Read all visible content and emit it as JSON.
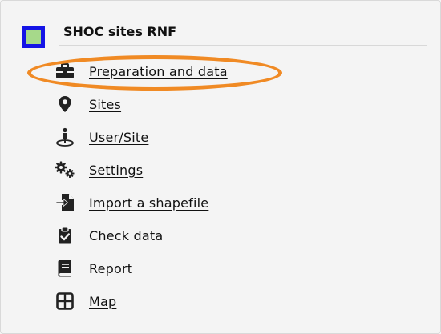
{
  "app": {
    "title": "SHOC sites RNF",
    "logo_fill": "#a6d98a",
    "logo_border": "#1414e6"
  },
  "highlight": {
    "color": "#f08a24",
    "target": "menu-item-preparation-and-data"
  },
  "menu": {
    "items": [
      {
        "label": "Preparation and data",
        "icon": "briefcase-icon"
      },
      {
        "label": "Sites",
        "icon": "map-marker-icon"
      },
      {
        "label": "User/Site",
        "icon": "user-location-icon"
      },
      {
        "label": "Settings",
        "icon": "gears-icon"
      },
      {
        "label": "Import a shapefile",
        "icon": "file-import-icon"
      },
      {
        "label": "Check data",
        "icon": "clipboard-check-icon"
      },
      {
        "label": "Report",
        "icon": "book-icon"
      },
      {
        "label": "Map",
        "icon": "grid-icon"
      }
    ]
  }
}
